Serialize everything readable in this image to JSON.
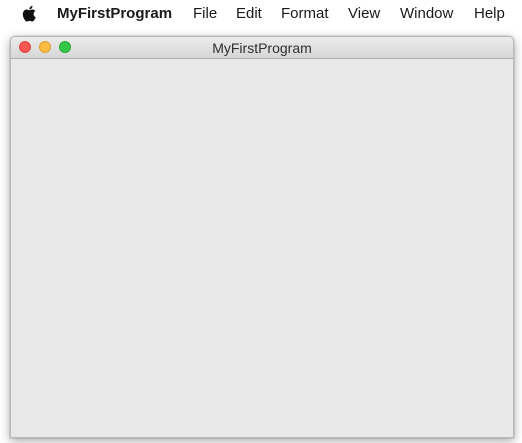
{
  "menubar": {
    "apple_icon": "apple-logo",
    "app_name": "MyFirstProgram",
    "items": [
      "File",
      "Edit",
      "Format",
      "View",
      "Window",
      "Help"
    ]
  },
  "window": {
    "title": "MyFirstProgram",
    "buttons": {
      "close_color": "#fc5753",
      "minimize_color": "#fdbc40",
      "zoom_color": "#33c748"
    }
  }
}
